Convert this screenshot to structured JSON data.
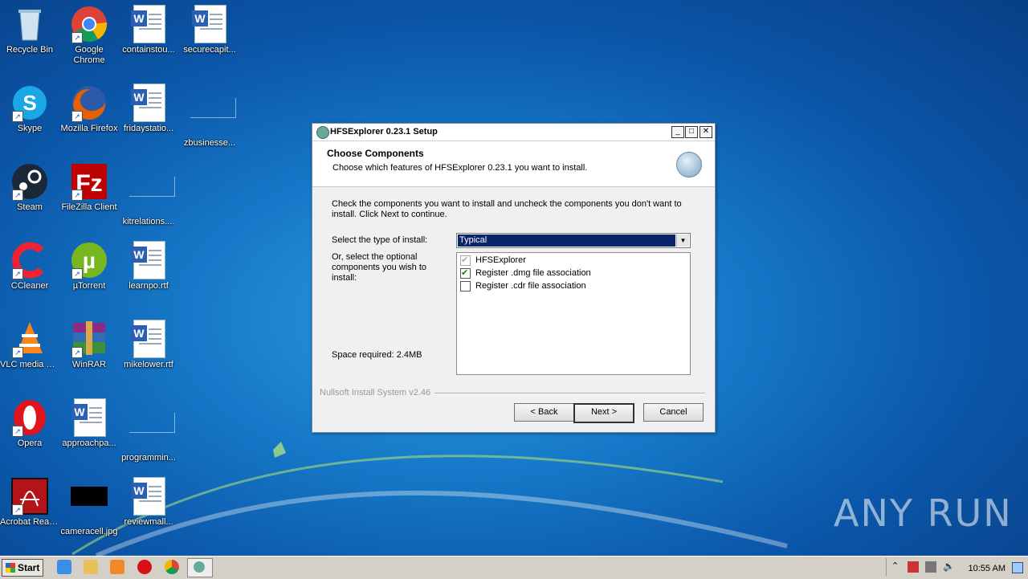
{
  "desktop": {
    "icons": [
      {
        "label": "Recycle Bin",
        "icon": "recycle-bin-icon"
      },
      {
        "label": "Google Chrome",
        "icon": "chrome-icon"
      },
      {
        "label": "containstou...",
        "icon": "word-doc-icon"
      },
      {
        "label": "securecapit...",
        "icon": "word-doc-icon"
      },
      {
        "label": "Skype",
        "icon": "skype-icon"
      },
      {
        "label": "Mozilla Firefox",
        "icon": "firefox-icon"
      },
      {
        "label": "fridaystatio...",
        "icon": "word-doc-icon"
      },
      {
        "label": "zbusinesse...",
        "icon": "blank-file-icon"
      },
      {
        "label": "Steam",
        "icon": "steam-icon"
      },
      {
        "label": "FileZilla Client",
        "icon": "filezilla-icon"
      },
      {
        "label": "kitrelations....",
        "icon": "blank-file-icon"
      },
      {
        "label": "CCleaner",
        "icon": "ccleaner-icon"
      },
      {
        "label": "µTorrent",
        "icon": "utorrent-icon"
      },
      {
        "label": "learnpo.rtf",
        "icon": "word-doc-icon"
      },
      {
        "label": "VLC media player",
        "icon": "vlc-icon"
      },
      {
        "label": "WinRAR",
        "icon": "winrar-icon"
      },
      {
        "label": "mikelower.rtf",
        "icon": "word-doc-icon"
      },
      {
        "label": "Opera",
        "icon": "opera-icon"
      },
      {
        "label": "approachpa...",
        "icon": "word-doc-icon"
      },
      {
        "label": "programmin...",
        "icon": "blank-file-icon"
      },
      {
        "label": "Acrobat Reader DC",
        "icon": "acrobat-icon"
      },
      {
        "label": "cameracell.jpg",
        "icon": "image-file-icon"
      },
      {
        "label": "reviewmall...",
        "icon": "word-doc-icon"
      }
    ]
  },
  "dialog": {
    "title": "HFSExplorer 0.23.1 Setup",
    "header_title": "Choose Components",
    "header_subtitle": "Choose which features of HFSExplorer 0.23.1 you want to install.",
    "instructions": "Check the components you want to install and uncheck the components you don't want to install. Click Next to continue.",
    "install_type_label": "Select the type of install:",
    "install_type_value": "Typical",
    "optional_label": "Or, select the optional components you wish to install:",
    "space_required": "Space required: 2.4MB",
    "components": [
      {
        "label": "HFSExplorer",
        "checked": true,
        "disabled": true
      },
      {
        "label": "Register .dmg file association",
        "checked": true,
        "disabled": false
      },
      {
        "label": "Register .cdr file association",
        "checked": false,
        "disabled": false
      }
    ],
    "branding": "Nullsoft Install System v2.46",
    "buttons": {
      "back": "< Back",
      "next": "Next >",
      "cancel": "Cancel"
    },
    "window_controls": {
      "minimize": "_",
      "maximize": "□",
      "close": "✕"
    }
  },
  "taskbar": {
    "start_label": "Start",
    "clock": "10:55 AM",
    "pinned": [
      "ie-icon",
      "explorer-icon",
      "media-player-icon",
      "opera-icon",
      "chrome-icon",
      "hfsexplorer-setup-icon"
    ]
  },
  "watermark": "ANY RUN"
}
